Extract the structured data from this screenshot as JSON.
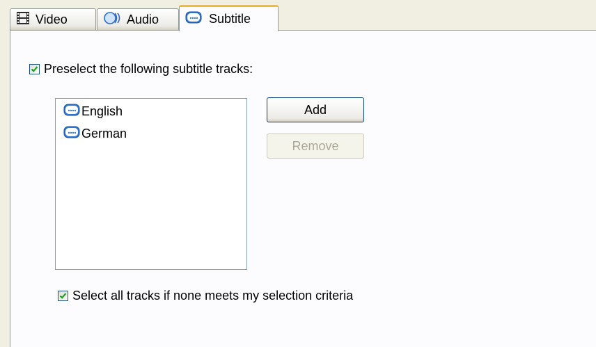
{
  "tabs": [
    {
      "label": "Video",
      "icon": "film-icon",
      "selected": false
    },
    {
      "label": "Audio",
      "icon": "audio-icon",
      "selected": false
    },
    {
      "label": "Subtitle",
      "icon": "subtitle-icon",
      "selected": true
    }
  ],
  "preselect": {
    "label": "Preselect the following subtitle tracks:",
    "checked": true
  },
  "tracks": [
    {
      "label": "English",
      "icon": "subtitle-icon"
    },
    {
      "label": "German",
      "icon": "subtitle-icon"
    }
  ],
  "buttons": {
    "add_label": "Add",
    "remove_label": "Remove",
    "remove_enabled": false
  },
  "select_all": {
    "label": "Select all tracks if none meets my selection criteria",
    "checked": true
  },
  "colors": {
    "tab_highlight": "#f8b932",
    "checkmark": "#21a121",
    "window_bg": "#f1efe2",
    "panel_bg": "#fcfcfe"
  }
}
